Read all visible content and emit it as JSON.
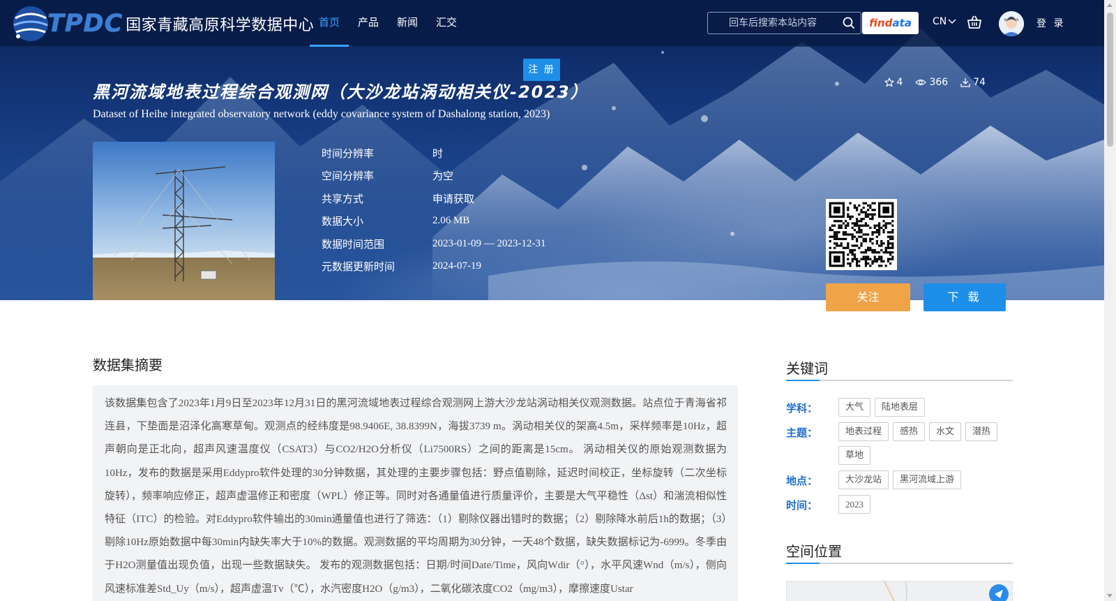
{
  "header": {
    "logo_abbr": "TPDC",
    "logo_name": "国家青藏高原科学数据中心",
    "nav": [
      {
        "label": "首页",
        "active": true
      },
      {
        "label": "产品",
        "active": false
      },
      {
        "label": "新闻",
        "active": false
      },
      {
        "label": "汇交",
        "active": false
      }
    ],
    "search_placeholder": "回车后搜索本站内容",
    "findata_part1": "find",
    "findata_part2": "ata",
    "lang": "CN",
    "login": "登 录",
    "register": "注 册"
  },
  "dataset": {
    "title_cn": "黑河流域地表过程综合观测网（大沙龙站涡动相关仪-2023）",
    "title_en": "Dataset of Heihe integrated observatory network (eddy covariance system of Dashalong station, 2023)",
    "stats": {
      "stars": "4",
      "views": "366",
      "downloads": "74"
    },
    "meta": [
      {
        "key": "时间分辨率",
        "value": "时"
      },
      {
        "key": "空间分辨率",
        "value": "为空"
      },
      {
        "key": "共享方式",
        "value": "申请获取"
      },
      {
        "key": "数据大小",
        "value": "2.06 MB"
      },
      {
        "key": "数据时间范围",
        "value": "2023-01-09 — 2023-12-31"
      },
      {
        "key": "元数据更新时间",
        "value": "2024-07-19"
      }
    ],
    "follow_label": "关注",
    "download_label": "下 载"
  },
  "abstract": {
    "heading": "数据集摘要",
    "text": "该数据集包含了2023年1月9日至2023年12月31日的黑河流域地表过程综合观测网上游大沙龙站涡动相关仪观测数据。站点位于青海省祁连县，下垫面是沼泽化高寒草甸。观测点的经纬度是98.9406E, 38.8399N，海拔3739 m。涡动相关仪的架高4.5m，采样频率是10Hz，超声朝向是正北向，超声风速温度仪（CSAT3）与CO2/H2O分析仪（Li7500RS）之间的距离是15cm。 涡动相关仪的原始观测数据为10Hz，发布的数据是采用Eddypro软件处理的30分钟数据，其处理的主要步骤包括：野点值剔除，延迟时间校正，坐标旋转（二次坐标旋转），频率响应修正，超声虚温修正和密度（WPL）修正等。同时对各通量值进行质量评价，主要是大气平稳性（Δst）和湍流相似性特征（ITC）的检验。对Eddypro软件输出的30min通量值也进行了筛选：（1）剔除仪器出错时的数据；（2）剔除降水前后1h的数据；（3）剔除10Hz原始数据中每30min内缺失率大于10%的数据。观测数据的平均周期为30分钟，一天48个数据，缺失数据标记为-6999。冬季由于H2O测量值出现负值，出现一些数据缺失。 发布的观测数据包括：日期/时间Date/Time，风向Wdir（°），水平风速Wnd（m/s），侧向风速标准差Std_Uy（m/s），超声虚温Tv（℃），水汽密度H2O（g/m3），二氧化碳浓度CO2（mg/m3），摩擦速度Ustar"
  },
  "keywords": {
    "heading": "关键词",
    "rows": [
      {
        "label": "学科：",
        "tags": [
          "大气",
          "陆地表层"
        ]
      },
      {
        "label": "主题：",
        "tags": [
          "地表过程",
          "感热",
          "水文",
          "潜热",
          "草地"
        ]
      },
      {
        "label": "地点：",
        "tags": [
          "大沙龙站",
          "黑河流域上游"
        ]
      },
      {
        "label": "时间：",
        "tags": [
          "2023"
        ]
      }
    ]
  },
  "spatial": {
    "heading": "空间位置"
  },
  "colors": {
    "accent": "#1e8fe8",
    "follow": "#f0a448",
    "nav_active": "#3aa0ff",
    "keyword_label": "#1e6fd0"
  },
  "icons": [
    "search-icon",
    "basket-icon",
    "chevron-down-icon",
    "star-icon",
    "eye-icon",
    "download-icon",
    "avatar"
  ]
}
